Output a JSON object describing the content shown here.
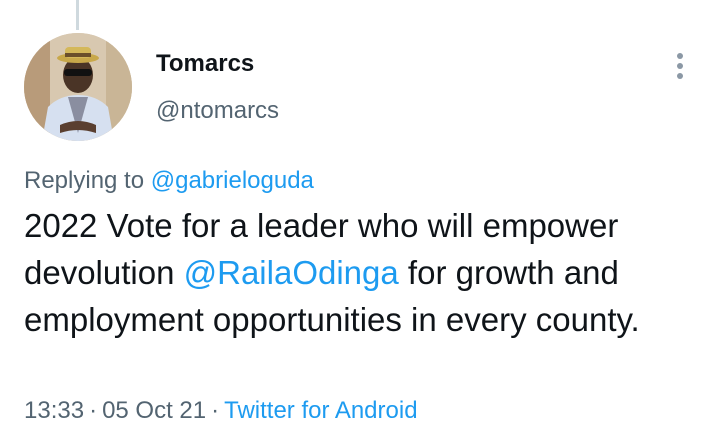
{
  "tweet": {
    "author_name": "Tomarcs",
    "author_handle": "@ntomarcs",
    "replying_prefix": "Replying to",
    "replying_to": "@gabrieloguda",
    "text_part1": "2022 Vote for a leader who will empower devolution ",
    "mention": "@RailaOdinga",
    "text_part2": " for growth and employment opportunities in every county.",
    "time": "13:33",
    "date": "05 Oct 21",
    "source": "Twitter for Android",
    "separator": "·"
  },
  "icons": {
    "more": "more-options-icon",
    "avatar": "avatar"
  },
  "colors": {
    "link": "#1d9bf0",
    "secondary_text": "#536471",
    "primary_text": "#0f1419"
  }
}
